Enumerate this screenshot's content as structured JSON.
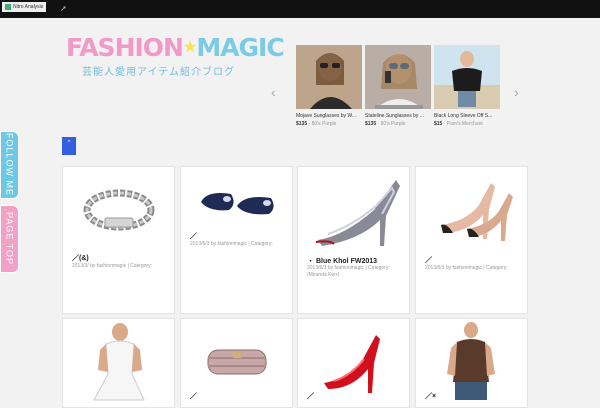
{
  "topbar": {
    "logo_text": "Nitro Analysis",
    "tool_icon": "cursor-icon"
  },
  "brand": {
    "word1": "FASHION",
    "word2": "MAGIC",
    "subtitle": "芸能人愛用アイテム紹介ブログ"
  },
  "carousel": {
    "items": [
      {
        "title": "Mojave Sunglasses by W...",
        "price": "$135",
        "seller": "80's Purple"
      },
      {
        "title": "Stateline Sunglasses by ...",
        "price": "$135",
        "seller": "80's Purple"
      },
      {
        "title": "Black Long Sleeve Off S...",
        "price": "$15",
        "seller": "Pam's Merchant"
      }
    ]
  },
  "side_tabs": {
    "follow": "FOLLOW ME",
    "pagetop": "PAGE TOP"
  },
  "blue_button": "^",
  "cards": [
    {
      "title": "／(&)",
      "meta": "2013/3/ by fashionmagic | Category:",
      "meta2": ""
    },
    {
      "title": "",
      "meta": "2013/6/3 by fashionmagic | Category:",
      "meta2": ""
    },
    {
      "title": "Blue Khol FW2013",
      "meta": "2013/6/3 by fashionmagic | Category:",
      "meta2": "(Miranda Kerr)"
    },
    {
      "title": "",
      "meta": "2013/6/3 by fashionmagic | Category:",
      "meta2": ""
    },
    {
      "title": "",
      "meta": "",
      "meta2": ""
    },
    {
      "title": "",
      "meta": "",
      "meta2": ""
    },
    {
      "title": "",
      "meta": "",
      "meta2": ""
    },
    {
      "title": "",
      "meta": "",
      "meta2": ""
    }
  ],
  "card_slashes": [
    "／",
    "／",
    "・",
    "／",
    "",
    "／",
    "／",
    "／×"
  ],
  "colors": {
    "pink": "#f29ac7",
    "cyan": "#7ccbe6",
    "blue": "#3060e0"
  }
}
